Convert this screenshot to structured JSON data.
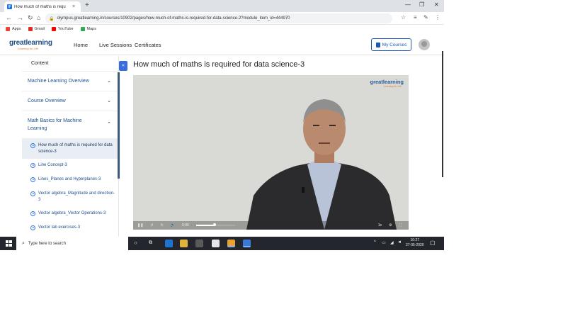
{
  "browser": {
    "tab_title": "How much of maths is requ",
    "tab_favicon": "gl",
    "new_tab_symbol": "+",
    "tab_close_symbol": "×",
    "url": "olympus.greatlearning.in/courses/10902/pages/how-much-of-maths-is-required-for-data-science-2?module_item_id=444970",
    "bookmarks": [
      {
        "label": "Apps",
        "color": "#e8453c"
      },
      {
        "label": "Gmail",
        "color": "#d93025"
      },
      {
        "label": "YouTube",
        "color": "#ff0000"
      },
      {
        "label": "Maps",
        "color": "#34a853"
      }
    ]
  },
  "site": {
    "logo": "greatlearning",
    "logo_tagline": "Learning for Life",
    "nav": [
      "Home",
      "Live Sessions",
      "Certificates"
    ],
    "my_courses": "My Courses",
    "brand_color": "#1e58b5"
  },
  "sidebar": {
    "heading": "Content",
    "sections": [
      {
        "label": "Machine Learning Overview",
        "chevron": "⌄"
      },
      {
        "label": "Course Overview",
        "chevron": "⌄"
      },
      {
        "label": "Math Basics for Machine Learning",
        "chevron": "⌃"
      }
    ],
    "items": [
      {
        "label": "How much of maths is required for data science-3",
        "active": true
      },
      {
        "label": "Line Concept-3"
      },
      {
        "label": "Lines_Planes and Hyperplanes-3"
      },
      {
        "label": "Vector algebra_Magnitude and direction-3"
      },
      {
        "label": "Vector algebra_Vector Operations-3"
      },
      {
        "label": "Vector lab exercises-3"
      }
    ],
    "collapse_symbol": "«"
  },
  "main": {
    "title": "How much of maths is required for data science-3",
    "video": {
      "watermark": "greatlearning",
      "watermark_sub": "Learning for Life",
      "time": "0:00",
      "progress": 0.47,
      "speed": "1x"
    }
  },
  "taskbar": {
    "search_placeholder": "Type here to search",
    "time": "10:27",
    "date": "27-05-2020"
  }
}
